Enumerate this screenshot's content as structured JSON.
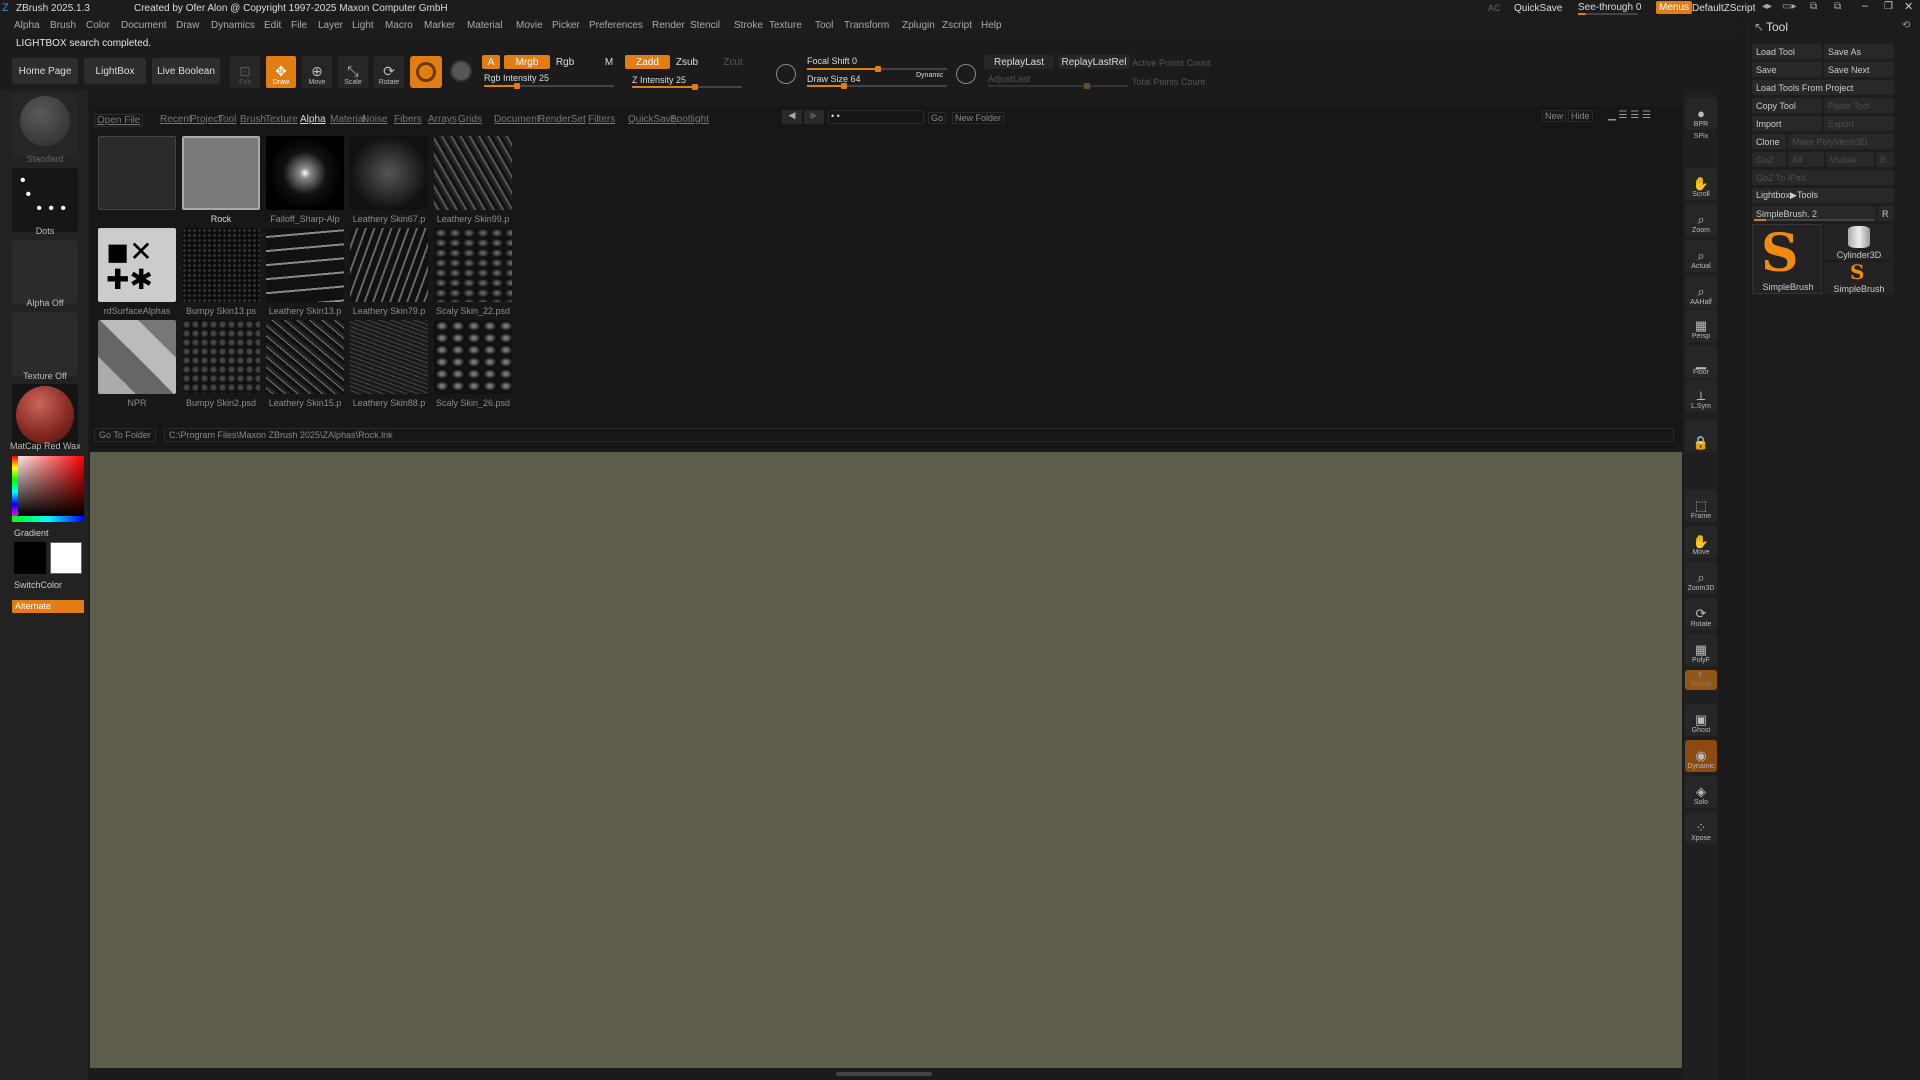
{
  "title": {
    "app_name": "ZBrush 2025.1.3",
    "credits": "Created by Ofer Alon @ Copyright 1997-2025 Maxon Computer GmbH",
    "ac": "AC",
    "quicksave": "QuickSave",
    "see_through": "See-through  0",
    "menus": "Menus",
    "default_zscript": "DefaultZScript"
  },
  "menubar": [
    "Alpha",
    "Brush",
    "Color",
    "Document",
    "Draw",
    "Dynamics",
    "Edit",
    "File",
    "Layer",
    "Light",
    "Macro",
    "Marker",
    "Material",
    "Movie",
    "Picker",
    "Preferences",
    "Render",
    "Stencil",
    "Stroke",
    "Texture",
    "Tool",
    "Transform",
    "Zplugin",
    "Zscript",
    "Help"
  ],
  "status": "LIGHTBOX search completed.",
  "shelf": {
    "home_page": "Home Page",
    "lightbox": "LightBox",
    "live_boolean": "Live Boolean",
    "edit": "Edit",
    "draw": "Draw",
    "move": "Move",
    "scale": "Scale",
    "rotate": "Rotate",
    "a": "A",
    "mrgb": "Mrgb",
    "rgb": "Rgb",
    "m": "M",
    "zadd": "Zadd",
    "zsub": "Zsub",
    "zcut": "Zcut",
    "rgb_intensity": "Rgb Intensity 25",
    "rgb_intensity_value": 0.25,
    "z_intensity": "Z Intensity 25",
    "z_intensity_value": 0.25,
    "focal_shift": "Focal Shift 0",
    "draw_size": "Draw Size 64",
    "dynamic": "Dynamic",
    "replay_last": "ReplayLast",
    "replay_last_rel": "ReplayLastRel",
    "adjust_last": "AdjustLast",
    "active_points": "Active Points Count",
    "total_points": "Total Points Count"
  },
  "left": {
    "standard": "Standard",
    "dots": "Dots",
    "alpha_off": "Alpha Off",
    "texture_off": "Texture Off",
    "matcap": "MatCap Red Wax",
    "gradient": "Gradient",
    "switchcolor": "SwitchColor",
    "alternate": "Alternate"
  },
  "lightbox": {
    "open_file": "Open File",
    "tabs": [
      "Recent",
      "Project",
      "Tool",
      "Brush",
      "Texture",
      "Alpha",
      "Material",
      "Noise",
      "Fibers",
      "Arrays",
      "Grids",
      "Document",
      "RenderSet",
      "Filters",
      "QuickSave",
      "Spotlight"
    ],
    "active_tab": "Alpha",
    "path_field": "• •",
    "go": "Go",
    "new_folder": "New Folder",
    "new": "New",
    "hide": "Hide",
    "items": [
      {
        "label": ""
      },
      {
        "label": "Rock"
      },
      {
        "label": "Falloff_Sharp-Alp"
      },
      {
        "label": "Leathery Skin67.p"
      },
      {
        "label": "Leathery Skin99.p"
      },
      {
        "label": "rdSurfaceAlphas"
      },
      {
        "label": "Bumpy Skin13.ps"
      },
      {
        "label": "Leathery Skin13.p"
      },
      {
        "label": "Leathery Skin79.p"
      },
      {
        "label": "Scaly Skin_22.psd"
      },
      {
        "label": "NPR"
      },
      {
        "label": "Bumpy Skin2.psd"
      },
      {
        "label": "Leathery Skin15.p"
      },
      {
        "label": "Leathery Skin88.p"
      },
      {
        "label": "Scaly Skin_26.psd"
      }
    ],
    "go_to_folder": "Go To Folder",
    "path": "C:\\Program Files\\Maxon ZBrush 2025\\ZAlphas\\Rock.lnk"
  },
  "right_shelf": [
    "BPR",
    "SPix",
    "Scroll",
    "Zoom",
    "Actual",
    "AAHalf",
    "Persp",
    "Floor",
    "L.Sym",
    "",
    "Frame",
    "Move",
    "Zoom3D",
    "Rotate",
    "PolyF",
    "Transp",
    "Ghost",
    "Dynamic",
    "Solo",
    "Xpose"
  ],
  "tool": {
    "header": "Tool",
    "load_tool": "Load Tool",
    "save_as": "Save As",
    "save": "Save",
    "save_next": "Save Next",
    "load_from_project": "Load Tools From Project",
    "copy_tool": "Copy Tool",
    "paste_tool": "Paste Tool",
    "import": "Import",
    "export": "Export",
    "clone": "Clone",
    "make_polymesh": "Make PolyMesh3D",
    "goz": "GoZ",
    "all": "All",
    "visible": "Visible",
    "r": "R",
    "goz_ipad": "GoZ To iPad",
    "lightbox_tools": "Lightbox▶Tools",
    "current_tool": "SimpleBrush. 2",
    "thumbs": [
      {
        "label": "SimpleBrush"
      },
      {
        "label": "Cylinder3D"
      },
      {
        "label": "SimpleBrush"
      }
    ]
  },
  "colors": {
    "accent": "#e37c13",
    "canvas": "#5e5c4a",
    "bg": "#1b1b1b"
  }
}
